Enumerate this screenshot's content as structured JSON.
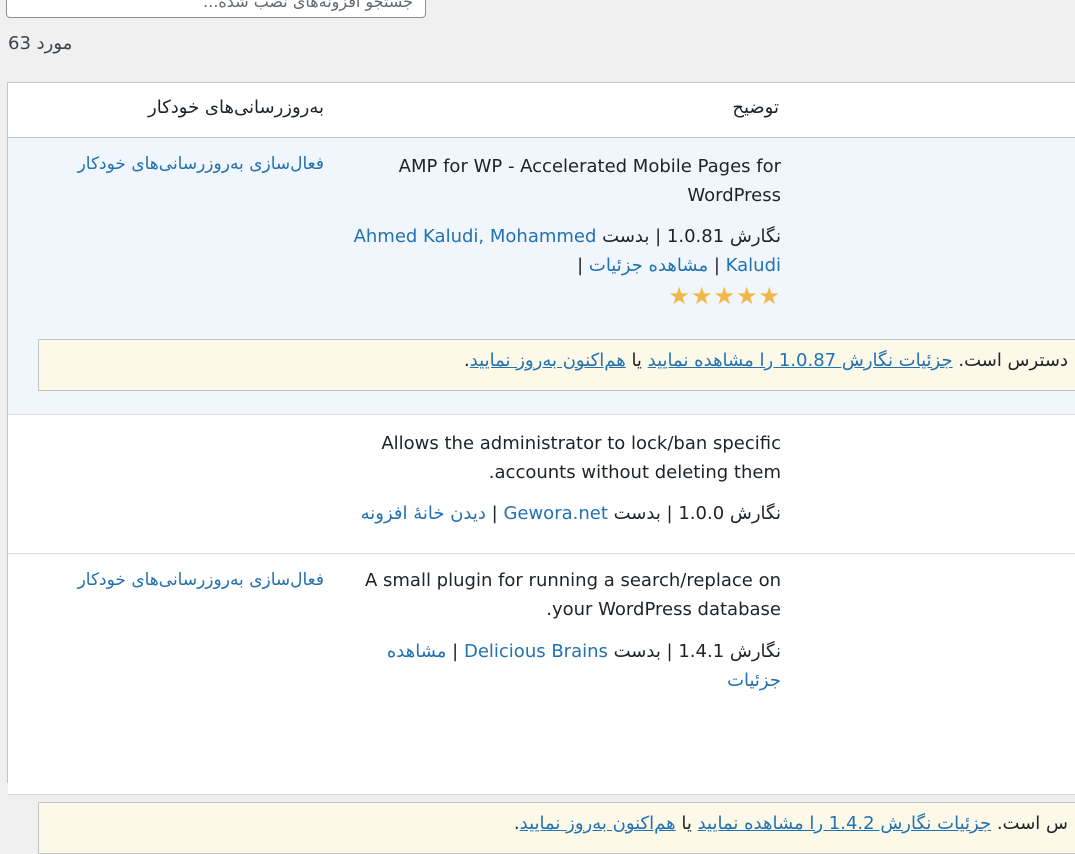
{
  "search": {
    "placeholder": "جستجو افزونه‌های نصب شده..."
  },
  "items_count": "63 مورد",
  "columns": {
    "description": "توضیح",
    "auto_updates": "به‌روزرسانی‌های خودکار"
  },
  "rows": [
    {
      "description": "AMP for WP - Accelerated Mobile Pages for WordPress",
      "version_text": "نگارش 1.0.81 | بدست",
      "author1": "Ahmed Kaludi,",
      "author2": "Mohammed Kaludi",
      "sep": "|",
      "details": "مشاهده جزئیات",
      "sep2": "|",
      "stars": "★★★★★",
      "auto_update": "فعال‌سازی به‌روزرسانی‌های خودکار",
      "notice": {
        "prefix": "دسترس است.",
        "details_link": "جزئیات نگارش 1.0.87 را مشاهده نمایید",
        "mid": "یا",
        "update_link": "هم‌اکنون به‌روز نمایید",
        "suffix": "."
      }
    },
    {
      "description": "Allows the administrator to lock/ban specific accounts without deleting them.",
      "version_text": "نگارش 1.0.0 | بدست",
      "author1": "Gewora.net",
      "sep": "|",
      "details": "دیدن خانهٔ افزونه"
    },
    {
      "description": "A small plugin for running a search/replace on your WordPress database.",
      "version_text": "نگارش 1.4.1 | بدست",
      "author1": "Delicious Brains",
      "sep": "|",
      "details": "مشاهده جزئیات",
      "auto_update": "فعال‌سازی به‌روزرسانی‌های خودکار",
      "notice": {
        "prefix": "س است.",
        "details_link": "جزئیات نگارش 1.4.2 را مشاهده نمایید",
        "mid": "یا",
        "update_link": "هم‌اکنون به‌روز نمایید",
        "suffix": "."
      }
    }
  ],
  "colors": {
    "link": "#2271b1",
    "active_row": "#f0f6fc",
    "notice_bg": "#fcf9e8",
    "star": "#f0b849"
  }
}
